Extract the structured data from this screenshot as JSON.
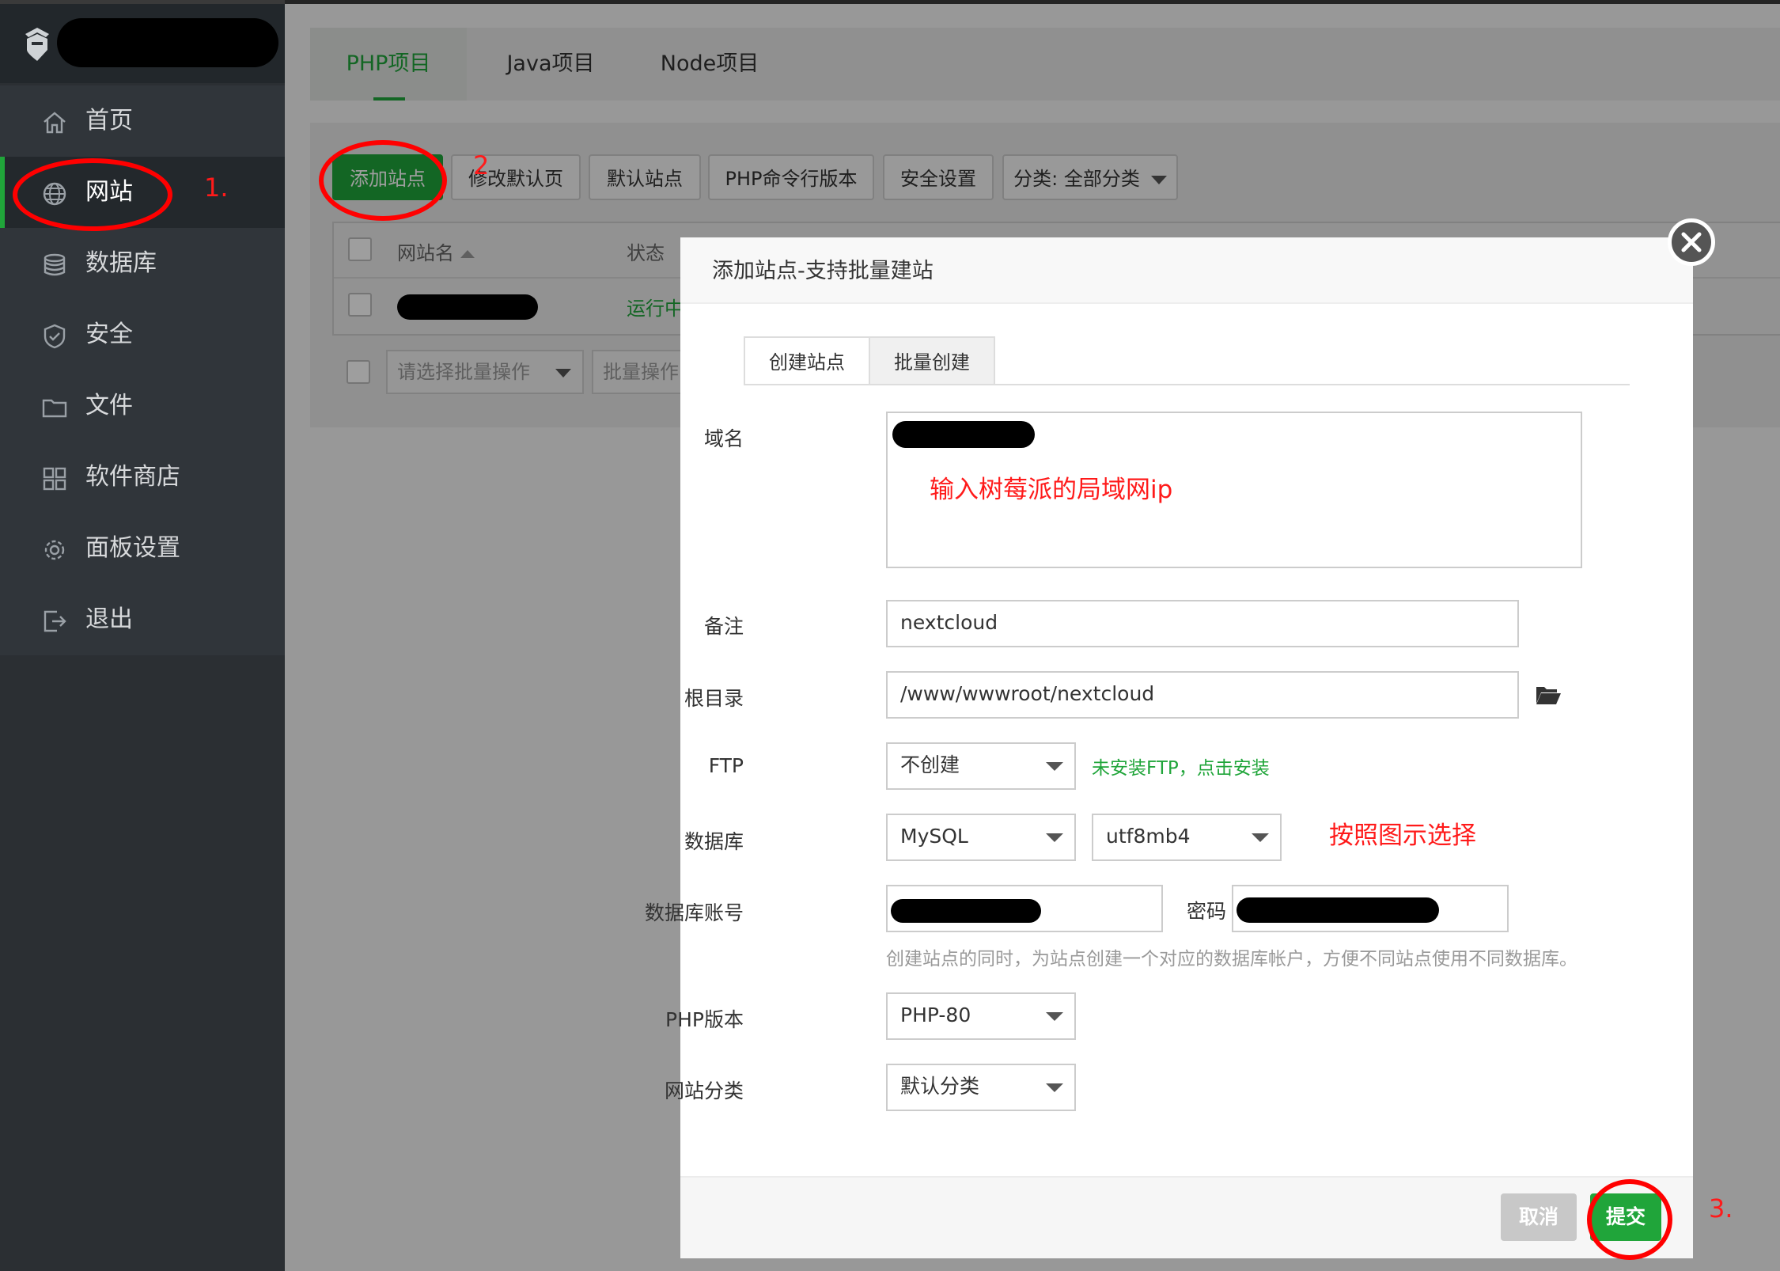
{
  "sidebar": {
    "items": [
      {
        "label": "首页",
        "icon": "home-icon"
      },
      {
        "label": "网站",
        "icon": "globe-icon"
      },
      {
        "label": "数据库",
        "icon": "database-icon"
      },
      {
        "label": "安全",
        "icon": "shield-icon"
      },
      {
        "label": "文件",
        "icon": "folder-icon"
      },
      {
        "label": "软件商店",
        "icon": "grid-icon"
      },
      {
        "label": "面板设置",
        "icon": "gear-icon"
      },
      {
        "label": "退出",
        "icon": "logout-icon"
      }
    ]
  },
  "annotations": {
    "step1": "1.",
    "step2": "2",
    "step3": "3.",
    "domain_note": "输入树莓派的局域网ip",
    "db_note": "按照图示选择"
  },
  "project_tabs": [
    "PHP项目",
    "Java项目",
    "Node项目"
  ],
  "toolbar": {
    "add_site": "添加站点",
    "edit_default_page": "修改默认页",
    "default_site": "默认站点",
    "php_cli_version": "PHP命令行版本",
    "security_settings": "安全设置",
    "category_filter": "分类: 全部分类"
  },
  "table": {
    "col_name": "网站名",
    "col_status": "状态",
    "row_status": "运行中",
    "batch_placeholder": "请选择批量操作",
    "batch_button": "批量操作"
  },
  "modal": {
    "title": "添加站点-支持批量建站",
    "tabs": [
      "创建站点",
      "批量创建"
    ],
    "domain_label": "域名",
    "remark_label": "备注",
    "remark_value": "nextcloud",
    "root_label": "根目录",
    "root_value": "/www/wwwroot/nextcloud",
    "ftp_label": "FTP",
    "ftp_value": "不创建",
    "ftp_link": "未安装FTP，点击安装",
    "db_label": "数据库",
    "db_type": "MySQL",
    "db_charset": "utf8mb4",
    "db_account_label": "数据库账号",
    "password_label": "密码",
    "db_hint": "创建站点的同时，为站点创建一个对应的数据库帐户，方便不同站点使用不同数据库。",
    "php_label": "PHP版本",
    "php_value": "PHP-80",
    "category_label": "网站分类",
    "category_value": "默认分类",
    "cancel": "取消",
    "submit": "提交"
  },
  "colors": {
    "accent": "#20a53a",
    "annotation": "#ff0000",
    "sidebar": "#2b2f33"
  }
}
